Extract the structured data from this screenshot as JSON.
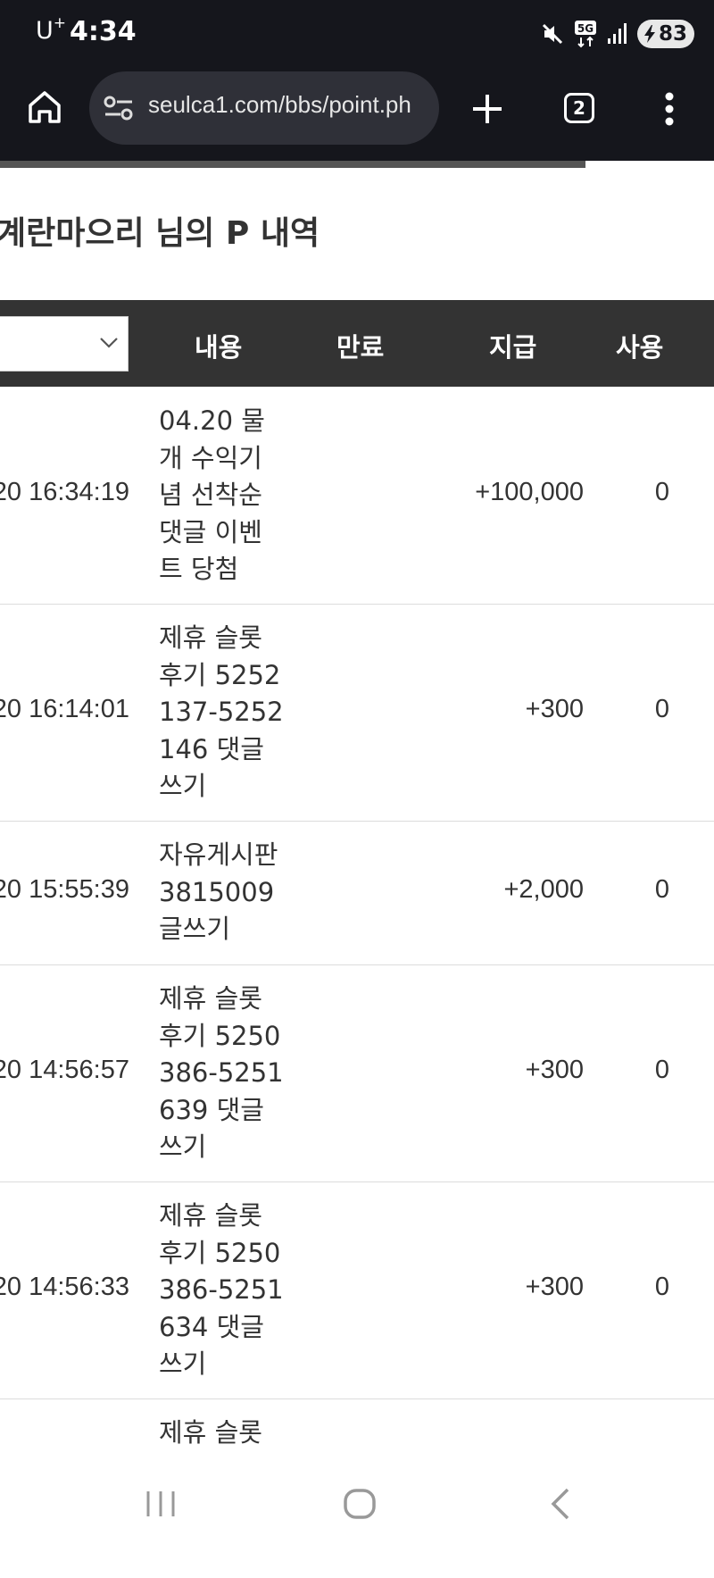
{
  "status_bar": {
    "carrier": "U",
    "carrier_sup": "+",
    "time": "4:34",
    "network": "5G",
    "battery": "83"
  },
  "browser": {
    "url": "seulca1.com/bbs/point.ph",
    "tab_count": "2",
    "load_progress": 0.82
  },
  "page": {
    "title": "계란마으리 님의 P 내역"
  },
  "table": {
    "headers": {
      "content": "내용",
      "expiry": "만료",
      "grant": "지급",
      "used": "사용"
    },
    "rows": [
      {
        "date": "20 16:34:19",
        "content": "04.20 물개 수익기념 선착순 댓글 이벤트 당첨",
        "expiry": "",
        "grant": "+100,000",
        "used": "0"
      },
      {
        "date": "20 16:14:01",
        "content": "제휴 슬롯 후기 5252137-5252146 댓글쓰기",
        "expiry": "",
        "grant": "+300",
        "used": "0"
      },
      {
        "date": "20 15:55:39",
        "content": "자유게시판 3815009 글쓰기",
        "expiry": "",
        "grant": "+2,000",
        "used": "0"
      },
      {
        "date": "20 14:56:57",
        "content": "제휴 슬롯 후기 5250386-5251639 댓글쓰기",
        "expiry": "",
        "grant": "+300",
        "used": "0"
      },
      {
        "date": "20 14:56:33",
        "content": "제휴 슬롯 후기 5250386-5251634 댓글쓰기",
        "expiry": "",
        "grant": "+300",
        "used": "0"
      },
      {
        "date": "",
        "content": "제휴 슬롯",
        "expiry": "",
        "grant": "",
        "used": ""
      }
    ]
  },
  "icons": {
    "home": "home-icon",
    "site_settings": "tune-icon",
    "new_tab": "plus-icon",
    "menu": "more-vert-icon",
    "recents": "recents-icon",
    "home_nav": "home-circle-icon",
    "back": "back-icon"
  }
}
